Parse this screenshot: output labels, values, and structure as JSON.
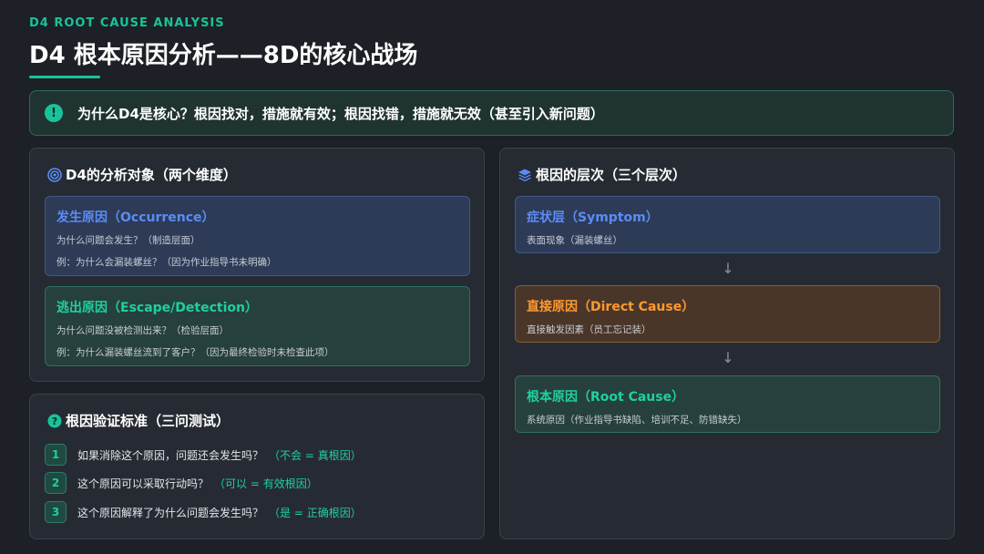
{
  "header": {
    "eyebrow": "D4 ROOT CAUSE ANALYSIS",
    "title": "D4 根本原因分析——8D的核心战场"
  },
  "banner": {
    "icon": "exclamation-icon",
    "text": "为什么D4是核心？根因找对，措施就有效；根因找错，措施就无效（甚至引入新问题）"
  },
  "analysis": {
    "title": "D4的分析对象（两个维度）",
    "cards": [
      {
        "title": "发生原因（Occurrence）",
        "line1": "为什么问题会发生？（制造层面）",
        "line2": "例：为什么会漏装螺丝？（因为作业指导书未明确）"
      },
      {
        "title": "逃出原因（Escape/Detection）",
        "line1": "为什么问题没被检测出来？（检验层面）",
        "line2": "例：为什么漏装螺丝流到了客户？（因为最终检验时未检查此项）"
      }
    ]
  },
  "verification": {
    "title": "根因验证标准（三问测试）",
    "tests": [
      {
        "num": "1",
        "question": "如果消除这个原因，问题还会发生吗？",
        "answer": "（不会 = 真根因）"
      },
      {
        "num": "2",
        "question": "这个原因可以采取行动吗？",
        "answer": "（可以 = 有效根因）"
      },
      {
        "num": "3",
        "question": "这个原因解释了为什么问题会发生吗？",
        "answer": "（是 = 正确根因）"
      }
    ]
  },
  "levels": {
    "title": "根因的层次（三个层次）",
    "arrow": "↓",
    "items": [
      {
        "title": "症状层（Symptom）",
        "desc": "表面现象（漏装螺丝）"
      },
      {
        "title": "直接原因（Direct Cause）",
        "desc": "直接触发因素（员工忘记装）"
      },
      {
        "title": "根本原因（Root Cause）",
        "desc": "系统原因（作业指导书缺陷、培训不足、防错缺失）"
      }
    ]
  },
  "colors": {
    "accent": "#19c39a",
    "blue": "#5b8cf5",
    "orange": "#ff9a2e",
    "background": "#1d2026"
  }
}
